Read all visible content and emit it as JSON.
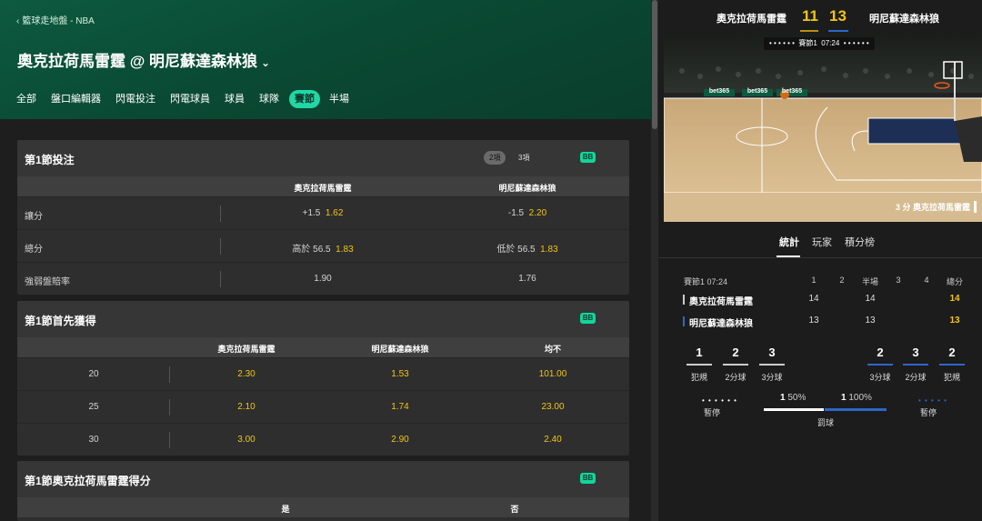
{
  "header": {
    "breadcrumb": "籃球走地盤 - NBA",
    "title": "奧克拉荷馬雷霆 @ 明尼蘇達森林狼",
    "tabs": [
      "全部",
      "盤口編輯器",
      "閃電投注",
      "閃電球員",
      "球員",
      "球隊",
      "賽節",
      "半場"
    ],
    "active_tab": "賽節"
  },
  "market1": {
    "title": "第1節投注",
    "pill_on": "2項",
    "pill_off": "3項",
    "badge": "BB",
    "cols": [
      "奧克拉荷馬雷霆",
      "明尼蘇達森林狼"
    ],
    "rows": [
      {
        "label": "讓分",
        "home_line": "+1.5",
        "home_odds": "1.62",
        "away_line": "-1.5",
        "away_odds": "2.20"
      },
      {
        "label": "總分",
        "home_line": "高於 56.5",
        "home_odds": "1.83",
        "away_line": "低於 56.5",
        "away_odds": "1.83"
      },
      {
        "label": "強弱盤賠率",
        "home_line": "",
        "home_odds": "1.90",
        "away_line": "",
        "away_odds": "1.76"
      }
    ]
  },
  "market2": {
    "title": "第1節首先獲得",
    "badge": "BB",
    "cols": [
      "奧克拉荷馬雷霆",
      "明尼蘇達森林狼",
      "均不"
    ],
    "rows": [
      {
        "label": "20",
        "a": "2.30",
        "b": "1.53",
        "c": "101.00"
      },
      {
        "label": "25",
        "a": "2.10",
        "b": "1.74",
        "c": "23.00"
      },
      {
        "label": "30",
        "a": "3.00",
        "b": "2.90",
        "c": "2.40"
      }
    ]
  },
  "market3": {
    "title": "第1節奧克拉荷馬雷霆得分",
    "badge": "BB",
    "cols": [
      "是",
      "否"
    ]
  },
  "scoreboard": {
    "home": "奧克拉荷馬雷霆",
    "home_score": "11",
    "away_score": "13",
    "away": "明尼蘇達森林狼"
  },
  "viz": {
    "dots_left": "• • • • • •",
    "period": "賽節1",
    "clock": "07:24",
    "dots_right": "• • • • • •",
    "caption": "3 分 奧克拉荷馬雷霆",
    "ad1": "bet365",
    "ad2": "bet365",
    "ad3": "bet365"
  },
  "stats_tabs": [
    "統計",
    "玩家",
    "積分榜"
  ],
  "stats": {
    "period_clock": "賽節1  07:24",
    "headers": [
      "1",
      "2",
      "半場",
      "3",
      "4",
      "總分"
    ],
    "teams": [
      {
        "name": "奧克拉荷馬雷霆",
        "q1": "14",
        "q2": "",
        "half": "14",
        "q3": "",
        "q4": "",
        "total": "14",
        "color": "#cccccc"
      },
      {
        "name": "明尼蘇達森林狼",
        "q1": "13",
        "q2": "",
        "half": "13",
        "q3": "",
        "q4": "",
        "total": "13",
        "color": "#2d66c9"
      }
    ]
  },
  "box": {
    "home": [
      {
        "v": "1",
        "l": "犯規"
      },
      {
        "v": "2",
        "l": "2分球"
      },
      {
        "v": "3",
        "l": "3分球"
      }
    ],
    "away": [
      {
        "v": "2",
        "l": "3分球"
      },
      {
        "v": "3",
        "l": "2分球"
      },
      {
        "v": "2",
        "l": "犯規"
      }
    ],
    "timeout_label": "暫停",
    "timeout_dots": "• • • • • •",
    "away_timeout_dots": "• • • • •",
    "ft_home": "1",
    "ft_home_pct": "50%",
    "ft_away": "1",
    "ft_away_pct": "100%",
    "ft_label": "罰球"
  },
  "colors": {
    "accent": "#20d8a6",
    "odds": "#f2c511",
    "away_blue": "#2d66c9",
    "header_green": "#0d5a40"
  }
}
